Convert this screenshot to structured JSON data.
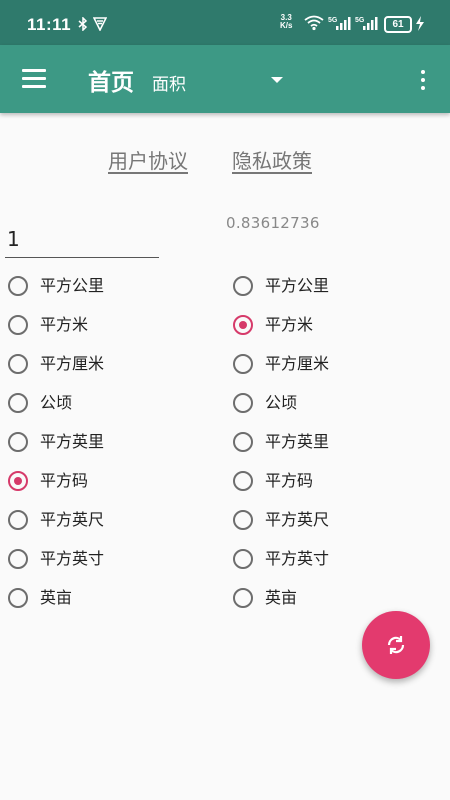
{
  "status_bar": {
    "time": "11:11",
    "net_speed_value": "3.3",
    "net_speed_unit": "K/s",
    "battery": "61",
    "icons": [
      "bluetooth-icon",
      "vpn-icon",
      "wifi-icon",
      "signal-icon",
      "signal-icon",
      "battery-icon",
      "charging-icon"
    ]
  },
  "appbar": {
    "title": "首页",
    "category_selected": "面积",
    "icons": [
      "menu-icon",
      "dropdown-arrow-icon",
      "overflow-icon"
    ]
  },
  "links": {
    "agreement": "用户协议",
    "privacy": "隐私政策"
  },
  "converter": {
    "input_value": "1",
    "result_value": "0.83612736",
    "from_units": [
      {
        "label": "平方公里",
        "checked": false
      },
      {
        "label": "平方米",
        "checked": false
      },
      {
        "label": "平方厘米",
        "checked": false
      },
      {
        "label": "公顷",
        "checked": false
      },
      {
        "label": "平方英里",
        "checked": false
      },
      {
        "label": "平方码",
        "checked": true
      },
      {
        "label": "平方英尺",
        "checked": false
      },
      {
        "label": "平方英寸",
        "checked": false
      },
      {
        "label": "英亩",
        "checked": false
      }
    ],
    "to_units": [
      {
        "label": "平方公里",
        "checked": false
      },
      {
        "label": "平方米",
        "checked": true
      },
      {
        "label": "平方厘米",
        "checked": false
      },
      {
        "label": "公顷",
        "checked": false
      },
      {
        "label": "平方英里",
        "checked": false
      },
      {
        "label": "平方码",
        "checked": false
      },
      {
        "label": "平方英尺",
        "checked": false
      },
      {
        "label": "平方英寸",
        "checked": false
      },
      {
        "label": "英亩",
        "checked": false
      }
    ]
  },
  "fab": {
    "icon": "swap-icon"
  },
  "colors": {
    "statusbar": "#2f7a6c",
    "appbar": "#3d9985",
    "accent": "#e33a6e"
  }
}
